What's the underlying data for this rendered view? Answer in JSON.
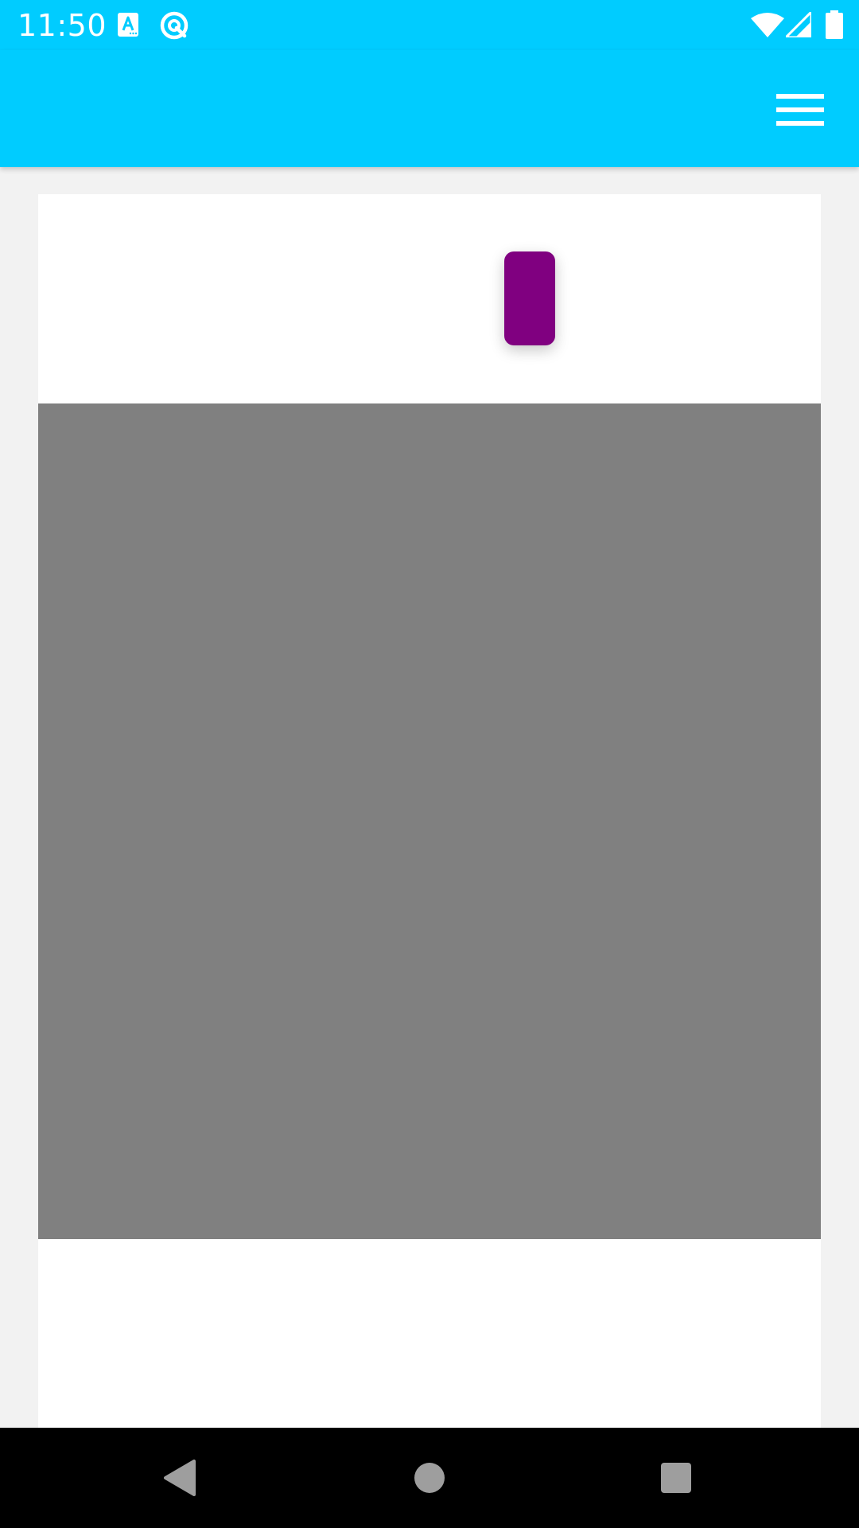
{
  "status_bar": {
    "time": "11:50",
    "background": "#00ccff",
    "left_icons": [
      "translate-app-icon",
      "sync-circle-icon"
    ],
    "right_icons": [
      "wifi-icon",
      "cell-signal-icon",
      "battery-icon"
    ]
  },
  "app_bar": {
    "background": "#00ccff",
    "menu_icon": "hamburger-menu-icon"
  },
  "content": {
    "background": "#ffffff",
    "page_background": "#f2f2f2",
    "accent_button_color": "#800080",
    "panel_color": "#808080"
  },
  "nav_bar": {
    "background": "#000000",
    "buttons": [
      "back-icon",
      "home-icon",
      "recents-icon"
    ],
    "icon_color": "#9e9e9e"
  }
}
